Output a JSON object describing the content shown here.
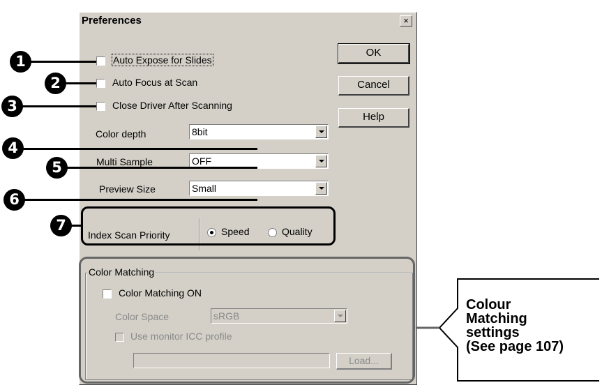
{
  "dialog": {
    "title": "Preferences",
    "close_label": "×",
    "buttons": {
      "ok": "OK",
      "cancel": "Cancel",
      "help": "Help"
    },
    "options": {
      "auto_expose": "Auto Expose for Slides",
      "auto_focus": "Auto Focus at Scan",
      "close_driver": "Close Driver After Scanning"
    },
    "color_depth": {
      "label": "Color depth",
      "value": "8bit"
    },
    "multi_sample": {
      "label": "Multi Sample",
      "value": "OFF"
    },
    "preview_size": {
      "label": "Preview Size",
      "value": "Small"
    },
    "index_scan": {
      "label": "Index Scan Priority",
      "speed": "Speed",
      "quality": "Quality",
      "selected": "Speed"
    },
    "color_matching": {
      "group_label": "Color Matching",
      "on_label": "Color Matching ON",
      "space_label": "Color Space",
      "space_value": "sRGB",
      "icc_label": "Use monitor ICC profile",
      "load_label": "Load..."
    }
  },
  "callouts": [
    "1",
    "2",
    "3",
    "4",
    "5",
    "6",
    "7"
  ],
  "annotation": {
    "line1": "Colour",
    "line2": "Matching",
    "line3": "settings",
    "line4": "(See page 107)"
  }
}
